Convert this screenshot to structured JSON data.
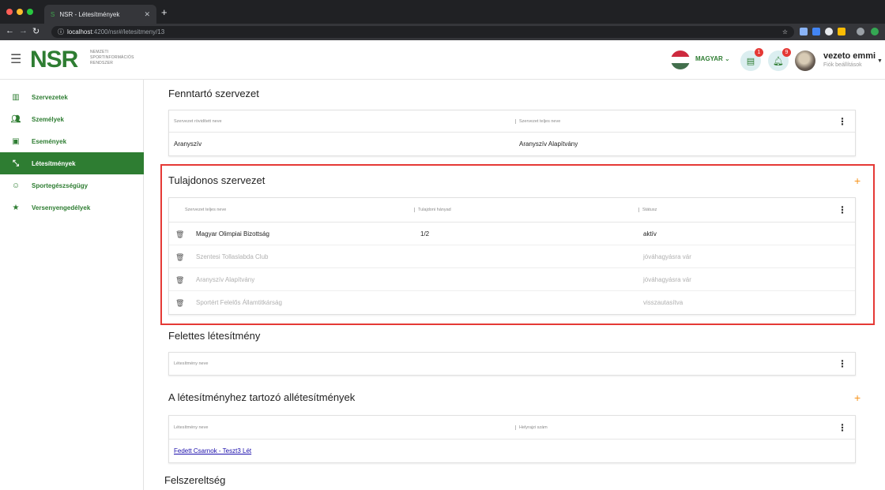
{
  "browser": {
    "tab_title": "NSR - Létesítmények",
    "url_host": "localhost",
    "url_rest": ":4200/nsr#/letesitmeny/13"
  },
  "app": {
    "logo": "NSR",
    "logo_sub_1": "NEMZETI",
    "logo_sub_2": "SPORTINFORMÁCIÓS",
    "logo_sub_3": "RENDSZER",
    "language": "MAGYAR",
    "notif_badge_1": "1",
    "notif_badge_2": "9",
    "user_name": "vezeto emmi",
    "user_sub": "Fiók beállítások"
  },
  "sidebar": {
    "items": [
      {
        "label": "Szervezetek",
        "icon": "building-icon"
      },
      {
        "label": "Személyek",
        "icon": "people-icon"
      },
      {
        "label": "Események",
        "icon": "calendar-icon"
      },
      {
        "label": "Létesítmények",
        "icon": "expand-arrows-icon"
      },
      {
        "label": "Sportegészségügy",
        "icon": "smiley-icon"
      },
      {
        "label": "Versenyengedélyek",
        "icon": "star-icon"
      }
    ]
  },
  "fenntarto": {
    "title": "Fenntartó szervezet",
    "col_short": "Szervezet rövidített neve",
    "col_full": "Szervezet teljes neve",
    "short_value": "Aranyszív",
    "full_value": "Aranyszív Alapítvány"
  },
  "tulajdonos": {
    "title": "Tulajdonos szervezet",
    "add": "+",
    "col_name": "Szervezet teljes neve",
    "col_share": "Tulajdoni hányad",
    "col_status": "Státusz",
    "rows": [
      {
        "name": "Magyar Olimpiai Bizottság",
        "share": "1/2",
        "status": "aktív"
      },
      {
        "name": "Szentesi Tollaslabda Club",
        "share": "",
        "status": "jóváhagyásra vár"
      },
      {
        "name": "Aranyszív Alapítvány",
        "share": "",
        "status": "jóváhagyásra vár"
      },
      {
        "name": "Sportért Felelős Államtitkárság",
        "share": "",
        "status": "visszautasítva"
      }
    ]
  },
  "felettes": {
    "title": "Felettes létesítmény",
    "col_name": "Létesítmény neve"
  },
  "alletesitmenyek": {
    "title": "A létesítményhez tartozó allétesítmények",
    "add": "+",
    "col_name": "Létesítmény neve",
    "col_hrsz": "Helyrajzi szám",
    "link": "Fedett Csarnok - Teszt3 Lét"
  },
  "felszereltseg": {
    "title": "Felszereltség"
  },
  "colors": {
    "brand_green": "#2e7d32",
    "accent_orange": "#f7941d",
    "highlight_red": "#e53935"
  }
}
